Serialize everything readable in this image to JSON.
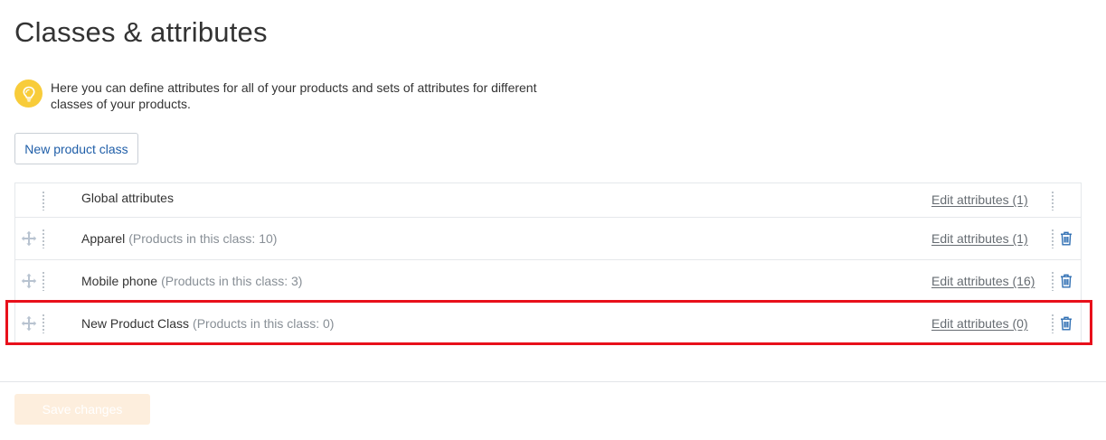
{
  "page": {
    "title": "Classes & attributes"
  },
  "info": {
    "icon": "lightbulb-icon",
    "icon_color": "#f8cc3a",
    "text": "Here you can define attributes for all of your products and sets of attributes for different classes of your products."
  },
  "actions": {
    "new_class_label": "New product class",
    "save_label": "Save changes"
  },
  "classes": [
    {
      "name": "Global attributes",
      "count_text": "",
      "edit_label": "Edit attributes (1)",
      "draggable": false,
      "deletable": false
    },
    {
      "name": "Apparel",
      "count_text": "(Products in this class: 10)",
      "edit_label": "Edit attributes (1)",
      "draggable": true,
      "deletable": true
    },
    {
      "name": "Mobile phone",
      "count_text": "(Products in this class: 3)",
      "edit_label": "Edit attributes (16)",
      "draggable": true,
      "deletable": true
    },
    {
      "name": "New Product Class",
      "count_text": "(Products in this class: 0)",
      "edit_label": "Edit attributes (0)",
      "draggable": true,
      "deletable": true
    }
  ],
  "colors": {
    "link": "#1f5ea8",
    "highlight": "#e8101b",
    "save_disabled_bg": "#fdeedd",
    "trash_icon": "#2f6fb3"
  }
}
